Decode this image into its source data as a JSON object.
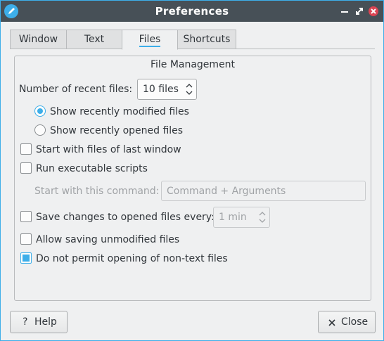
{
  "window": {
    "title": "Preferences",
    "icons": {
      "app": "pencil-icon",
      "minimize": "minimize-icon",
      "maximize": "maximize-icon",
      "close": "close-icon"
    },
    "accent_color": "#3daee9",
    "titlebar_color": "#475057"
  },
  "tabs": [
    {
      "label": "Window",
      "active": false
    },
    {
      "label": "Text",
      "active": false
    },
    {
      "label": "Files",
      "active": true
    },
    {
      "label": "Shortcuts",
      "active": false
    }
  ],
  "group": {
    "title": "File Management",
    "recent_files": {
      "label": "Number of recent files:",
      "value": "10 files"
    },
    "radios": [
      {
        "label": "Show recently modified files",
        "checked": true
      },
      {
        "label": "Show recently opened files",
        "checked": false
      }
    ],
    "checkboxes": {
      "start_last_window": {
        "label": "Start with files of last window",
        "checked": false
      },
      "run_scripts": {
        "label": "Run executable scripts",
        "checked": false
      },
      "save_changes": {
        "label": "Save changes to opened files every:",
        "checked": false
      },
      "allow_unmodified": {
        "label": "Allow saving unmodified files",
        "checked": false
      },
      "no_nontext": {
        "label": "Do not permit opening of non-text files",
        "checked": true
      }
    },
    "command": {
      "label": "Start with this command:",
      "placeholder": "Command + Arguments",
      "enabled": false
    },
    "autosave": {
      "value": "1 min",
      "enabled": false
    }
  },
  "footer": {
    "help": {
      "label": "Help",
      "icon": "question-icon"
    },
    "close": {
      "label": "Close",
      "icon": "x-icon"
    }
  }
}
